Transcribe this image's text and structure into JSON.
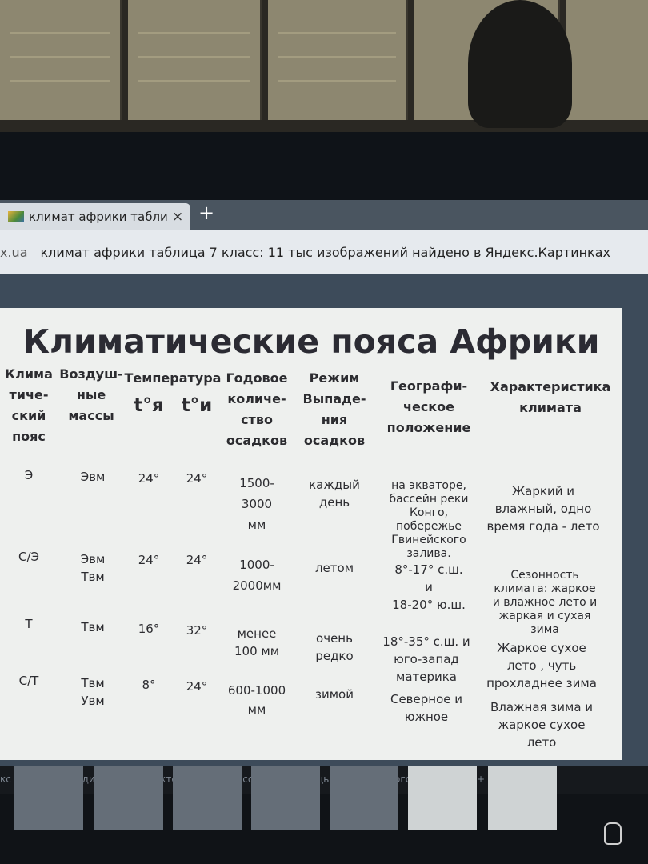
{
  "browser": {
    "tab_title": "климат африки таблица",
    "tab_close": "×",
    "new_tab": "+",
    "address_domain": "x.ua",
    "address_title": "климат африки таблица 7 класс: 11 тыс изображений найдено в Яндекс.Картинках"
  },
  "slide": {
    "title": "Климатические пояса Африки",
    "headers": {
      "belt": [
        "Клима",
        "тиче-",
        "ский",
        "пояс"
      ],
      "air": [
        "Воздуш-",
        "ные",
        "массы"
      ],
      "temp": "Температура",
      "t_jan": "t°я",
      "t_jul": "t°и",
      "precip": [
        "Годовое",
        "количе-",
        "ство",
        "осадков"
      ],
      "regime": [
        "Режим",
        "Выпаде-",
        "ния",
        "осадков"
      ],
      "geo": [
        "Географи-",
        "ческое",
        "положение"
      ],
      "char": [
        "Характеристика",
        "климата"
      ]
    },
    "rows": [
      {
        "belt": "Э",
        "air": [
          "Эвм"
        ],
        "t_jan": "24°",
        "t_jul": "24°",
        "precip": [
          "1500-",
          "3000",
          "мм"
        ],
        "regime": [
          "каждый",
          "день"
        ],
        "geo": [
          "на экваторе,",
          "бассейн реки",
          "Конго,",
          "побережье",
          "Гвинейского",
          "залива."
        ],
        "char": [
          "Жаркий и",
          "влажный, одно",
          "время года - лето"
        ]
      },
      {
        "belt": "С/Э",
        "air": [
          "Эвм",
          "Твм"
        ],
        "t_jan": "24°",
        "t_jul": "24°",
        "precip": [
          "1000-",
          "2000мм"
        ],
        "regime": [
          "летом"
        ],
        "geo": [
          "8°-17° с.ш.",
          "и",
          "18-20° ю.ш."
        ],
        "char": [
          "Сезонность",
          "климата: жаркое",
          "и влажное лето и",
          "жаркая и сухая",
          "зима"
        ]
      },
      {
        "belt": "Т",
        "air": [
          "Твм"
        ],
        "t_jan": "16°",
        "t_jul": "32°",
        "precip": [
          "менее",
          "100 мм"
        ],
        "regime": [
          "очень",
          "редко"
        ],
        "geo": [
          "18°-35° с.ш. и",
          "юго-запад",
          "материка"
        ],
        "char": [
          "Жаркое сухое",
          "лето , чуть",
          "прохладнее зима"
        ]
      },
      {
        "belt": "С/Т",
        "air": [
          "Твм",
          "Увм"
        ],
        "t_jan": "8°",
        "t_jul": "24°",
        "precip": [
          "600-1000",
          "мм"
        ],
        "regime": [
          "зимой"
        ],
        "geo": [
          "Северное и",
          "южное"
        ],
        "char": [
          "Влажная зима и",
          "жаркое сухое",
          "лето"
        ]
      }
    ]
  },
  "bottom_banner": "кс Браузер Заходите во Вконтакте и в Одноклассники с помощью обновленного Браузера 18+"
}
